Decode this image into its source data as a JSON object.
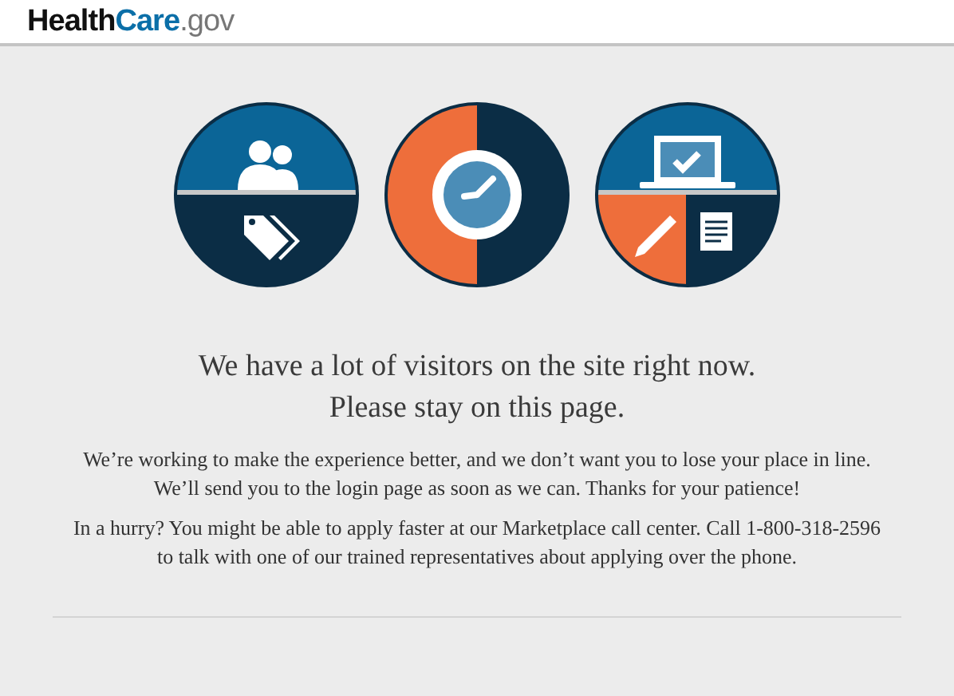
{
  "header": {
    "logo": [
      "Health",
      "Care",
      ".gov"
    ]
  },
  "message": {
    "heading": [
      "We have a lot of visitors on the site right now.",
      "Please stay on this page."
    ],
    "paragraphs": [
      "We’re working to make the experience better, and we don’t want you to lose your place in line. We’ll send you to the login page as soon as we can. Thanks for your patience!",
      "In a hurry? You might be able to apply faster at our Marketplace call center. Call 1-800-318-2596 to talk with one of our trained representatives about applying over the phone."
    ]
  }
}
